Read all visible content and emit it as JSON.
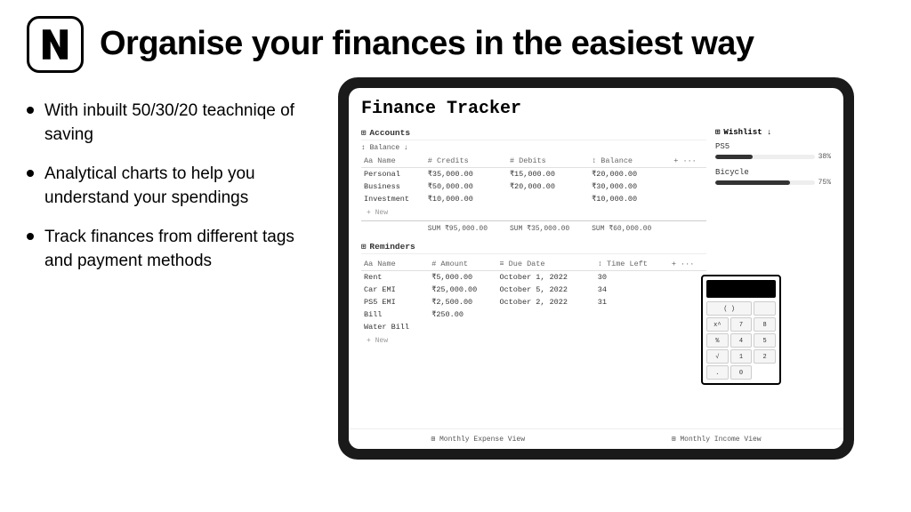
{
  "header": {
    "headline": "Organise your finances in the easiest way",
    "logo_alt": "Notion logo"
  },
  "bullets": [
    {
      "text": "With inbuilt 50/30/20 teachniqe of saving"
    },
    {
      "text": "Analytical charts to help you understand your spendings"
    },
    {
      "text": "Track finances from different tags and payment methods"
    }
  ],
  "finance_tracker": {
    "title": "Finance Tracker",
    "accounts_label": "Accounts",
    "balance_filter": "↕ Balance ↓",
    "columns_accounts": [
      "Name",
      "# Credits",
      "# Debits",
      "↕ Balance",
      "+ ..."
    ],
    "accounts_rows": [
      {
        "name": "Personal",
        "credits": "₹35,000.00",
        "debits": "₹15,000.00",
        "balance": "₹20,000.00"
      },
      {
        "name": "Business",
        "credits": "₹50,000.00",
        "debits": "₹20,000.00",
        "balance": "₹30,000.00"
      },
      {
        "name": "Investment",
        "credits": "₹10,000.00",
        "debits": "",
        "balance": "₹10,000.00"
      }
    ],
    "new_row_accounts": "+ New",
    "sum_row": {
      "credits": "SUM ₹95,000.00",
      "debits": "SUM ₹35,000.00",
      "balance": "SUM ₹60,000.00"
    },
    "reminders_label": "Reminders",
    "columns_reminders": [
      "Name",
      "# Amount",
      "≡ Due Date",
      "↕ Time Left",
      "+ ..."
    ],
    "reminders_rows": [
      {
        "name": "Rent",
        "amount": "₹5,000.00",
        "due_date": "October 1, 2022",
        "time_left": "30"
      },
      {
        "name": "Car EMI",
        "amount": "₹25,000.00",
        "due_date": "October 5, 2022",
        "time_left": "34"
      },
      {
        "name": "PS5 EMI",
        "amount": "₹2,500.00",
        "due_date": "October 2, 2022",
        "time_left": "31"
      },
      {
        "name": "Bill",
        "amount": "₹250.00",
        "due_date": "",
        "time_left": ""
      },
      {
        "name": "Water Bill",
        "amount": "",
        "due_date": "",
        "time_left": ""
      }
    ],
    "new_row_reminders": "+ New",
    "wishlist_label": "Wishlist ↓",
    "wishlist_items": [
      {
        "name": "PS5",
        "progress": 38,
        "label": "38%"
      },
      {
        "name": "Bicycle",
        "progress": 75,
        "label": "75%"
      }
    ],
    "calculator": {
      "buttons": [
        "( )",
        "",
        "x^",
        "7",
        "8",
        "%",
        "4",
        "5",
        "√",
        "1",
        "2",
        ".",
        "0"
      ]
    },
    "bottom_bar": [
      {
        "label": "⊞ Monthly Expense View"
      },
      {
        "label": "⊞ Monthly Income View"
      }
    ]
  }
}
